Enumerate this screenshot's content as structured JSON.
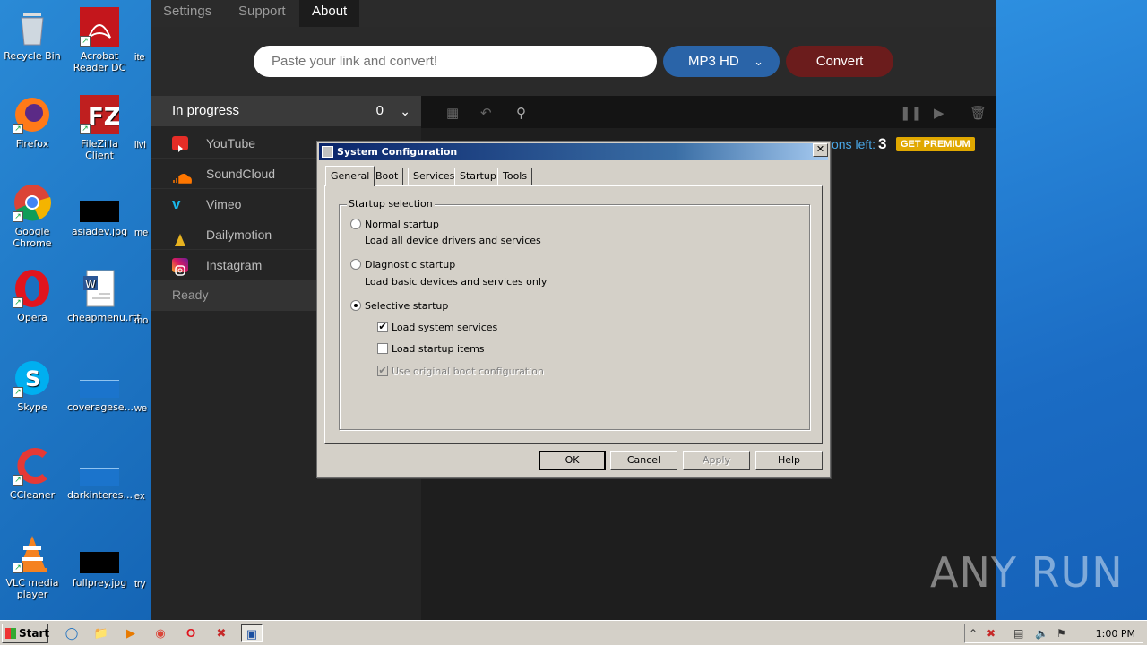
{
  "desktop": {
    "icons": [
      {
        "label": "Recycle Bin",
        "icon": "recycle-bin-icon"
      },
      {
        "label": "Acrobat Reader DC",
        "icon": "acrobat-icon"
      },
      {
        "label": "Firefox",
        "icon": "firefox-icon"
      },
      {
        "label": "FileZilla Client",
        "icon": "filezilla-icon"
      },
      {
        "label": "Google Chrome",
        "icon": "chrome-icon"
      },
      {
        "label": "asiadev.jpg",
        "icon": "image-file-icon"
      },
      {
        "label": "Opera",
        "icon": "opera-icon"
      },
      {
        "label": "cheapmenu.rtf",
        "icon": "word-doc-icon"
      },
      {
        "label": "Skype",
        "icon": "skype-icon"
      },
      {
        "label": "coveragese...",
        "icon": "file-icon"
      },
      {
        "label": "CCleaner",
        "icon": "ccleaner-icon"
      },
      {
        "label": "darkinteres...",
        "icon": "file-icon"
      },
      {
        "label": "VLC media player",
        "icon": "vlc-icon"
      },
      {
        "label": "fullprey.jpg",
        "icon": "image-file-icon"
      }
    ],
    "col3": [
      "ite",
      "livi",
      "me",
      "mo",
      "we",
      "ex",
      "try"
    ]
  },
  "app": {
    "tabs": [
      "Settings",
      "Support",
      "About"
    ],
    "link_placeholder": "Paste your link and convert!",
    "format": "MP3 HD",
    "convert_label": "Convert",
    "in_progress": {
      "label": "In progress",
      "count": "0"
    },
    "sources": [
      "YouTube",
      "SoundCloud",
      "Vimeo",
      "Dailymotion",
      "Instagram"
    ],
    "ready_label": "Ready",
    "conversions_left_label": "ons left:",
    "conversions_left": "3",
    "premium_label": "GET PREMIUM"
  },
  "dialog": {
    "title": "System Configuration",
    "tabs": [
      "General",
      "Boot",
      "Services",
      "Startup",
      "Tools"
    ],
    "group_label": "Startup selection",
    "normal": {
      "label": "Normal startup",
      "desc": "Load all device drivers and services"
    },
    "diagnostic": {
      "label": "Diagnostic startup",
      "desc": "Load basic devices and services only"
    },
    "selective": {
      "label": "Selective startup"
    },
    "load_system_services": "Load system services",
    "load_startup_items": "Load startup items",
    "use_original_boot": "Use original boot configuration",
    "buttons": {
      "ok": "OK",
      "cancel": "Cancel",
      "apply": "Apply",
      "help": "Help"
    }
  },
  "taskbar": {
    "start": "Start",
    "clock": "1:00 PM"
  },
  "watermark": "ANY RUN"
}
